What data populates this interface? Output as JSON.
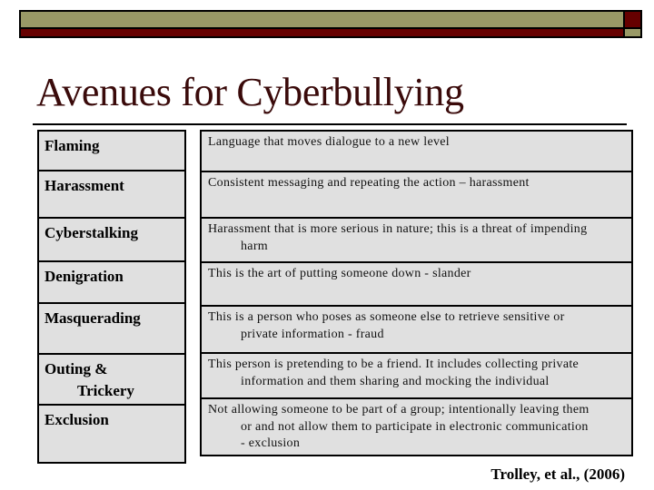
{
  "slide": {
    "title": "Avenues for Cyberbullying",
    "colors": {
      "olive": "#999966",
      "maroon": "#660000",
      "title_text": "#3a0a0a",
      "cell_background": "#e0e0e0"
    },
    "rows": [
      {
        "term": [
          "Flaming"
        ],
        "definition": [
          "Language that moves dialogue to a new level"
        ]
      },
      {
        "term": [
          "Harassment"
        ],
        "definition": [
          "Consistent messaging and repeating the action – harassment"
        ]
      },
      {
        "term": [
          "Cyberstalking"
        ],
        "definition": [
          "Harassment that is more serious in nature; this is a threat of impending",
          "harm"
        ]
      },
      {
        "term": [
          "Denigration"
        ],
        "definition": [
          "This is the art of putting someone down - slander"
        ]
      },
      {
        "term": [
          "Masquerading"
        ],
        "definition": [
          "This is a person who poses as someone else to retrieve sensitive or",
          "private information - fraud"
        ]
      },
      {
        "term": [
          "Outing &",
          "Trickery"
        ],
        "definition": [
          "This person is pretending to be a friend. It includes collecting private",
          "information and them sharing and mocking the individual"
        ]
      },
      {
        "term": [
          "Exclusion"
        ],
        "definition": [
          "Not allowing someone to be part of a group; intentionally leaving them",
          "or and not allow them to participate in electronic communication",
          "- exclusion"
        ]
      }
    ],
    "citation": "Trolley, et al., (2006)"
  }
}
